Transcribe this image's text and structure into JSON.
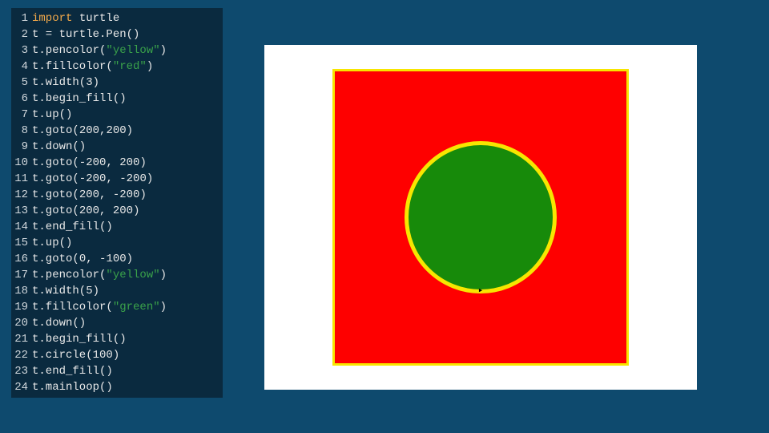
{
  "code": {
    "lines": [
      {
        "n": 1,
        "tokens": [
          [
            "kw",
            "import"
          ],
          [
            "plain",
            " turtle"
          ]
        ]
      },
      {
        "n": 2,
        "tokens": [
          [
            "plain",
            "t = turtle.Pen()"
          ]
        ]
      },
      {
        "n": 3,
        "tokens": [
          [
            "plain",
            "t.pencolor("
          ],
          [
            "str",
            "\"yellow\""
          ],
          [
            "plain",
            ")"
          ]
        ]
      },
      {
        "n": 4,
        "tokens": [
          [
            "plain",
            "t.fillcolor("
          ],
          [
            "str",
            "\"red\""
          ],
          [
            "plain",
            ")"
          ]
        ]
      },
      {
        "n": 5,
        "tokens": [
          [
            "plain",
            "t.width("
          ],
          [
            "num",
            "3"
          ],
          [
            "plain",
            ")"
          ]
        ]
      },
      {
        "n": 6,
        "tokens": [
          [
            "plain",
            "t.begin_fill()"
          ]
        ]
      },
      {
        "n": 7,
        "tokens": [
          [
            "plain",
            "t.up()"
          ]
        ]
      },
      {
        "n": 8,
        "tokens": [
          [
            "plain",
            "t.goto("
          ],
          [
            "num",
            "200"
          ],
          [
            "plain",
            ","
          ],
          [
            "num",
            "200"
          ],
          [
            "plain",
            ")"
          ]
        ]
      },
      {
        "n": 9,
        "tokens": [
          [
            "plain",
            "t.down()"
          ]
        ]
      },
      {
        "n": 10,
        "tokens": [
          [
            "plain",
            "t.goto(-"
          ],
          [
            "num",
            "200"
          ],
          [
            "plain",
            ", "
          ],
          [
            "num",
            "200"
          ],
          [
            "plain",
            ")"
          ]
        ]
      },
      {
        "n": 11,
        "tokens": [
          [
            "plain",
            "t.goto(-"
          ],
          [
            "num",
            "200"
          ],
          [
            "plain",
            ", -"
          ],
          [
            "num",
            "200"
          ],
          [
            "plain",
            ")"
          ]
        ]
      },
      {
        "n": 12,
        "tokens": [
          [
            "plain",
            "t.goto("
          ],
          [
            "num",
            "200"
          ],
          [
            "plain",
            ", -"
          ],
          [
            "num",
            "200"
          ],
          [
            "plain",
            ")"
          ]
        ]
      },
      {
        "n": 13,
        "tokens": [
          [
            "plain",
            "t.goto("
          ],
          [
            "num",
            "200"
          ],
          [
            "plain",
            ", "
          ],
          [
            "num",
            "200"
          ],
          [
            "plain",
            ")"
          ]
        ]
      },
      {
        "n": 14,
        "tokens": [
          [
            "plain",
            "t.end_fill()"
          ]
        ]
      },
      {
        "n": 15,
        "tokens": [
          [
            "plain",
            "t.up()"
          ]
        ]
      },
      {
        "n": 16,
        "tokens": [
          [
            "plain",
            "t.goto("
          ],
          [
            "num",
            "0"
          ],
          [
            "plain",
            ", -"
          ],
          [
            "num",
            "100"
          ],
          [
            "plain",
            ")"
          ]
        ]
      },
      {
        "n": 17,
        "tokens": [
          [
            "plain",
            "t.pencolor("
          ],
          [
            "str",
            "\"yellow\""
          ],
          [
            "plain",
            ")"
          ]
        ]
      },
      {
        "n": 18,
        "tokens": [
          [
            "plain",
            "t.width("
          ],
          [
            "num",
            "5"
          ],
          [
            "plain",
            ")"
          ]
        ]
      },
      {
        "n": 19,
        "tokens": [
          [
            "plain",
            "t.fillcolor("
          ],
          [
            "str",
            "\"green\""
          ],
          [
            "plain",
            ")"
          ]
        ]
      },
      {
        "n": 20,
        "tokens": [
          [
            "plain",
            "t.down()"
          ]
        ]
      },
      {
        "n": 21,
        "tokens": [
          [
            "plain",
            "t.begin_fill()"
          ]
        ]
      },
      {
        "n": 22,
        "tokens": [
          [
            "plain",
            "t.circle("
          ],
          [
            "num",
            "100"
          ],
          [
            "plain",
            ")"
          ]
        ]
      },
      {
        "n": 23,
        "tokens": [
          [
            "plain",
            "t.end_fill()"
          ]
        ]
      },
      {
        "n": 24,
        "tokens": [
          [
            "plain",
            "t.mainloop()"
          ]
        ]
      }
    ]
  },
  "output": {
    "square_fill": "#fe0000",
    "square_stroke": "#f7e600",
    "circle_fill": "#178a0a",
    "circle_stroke": "#f7e600",
    "canvas_bg": "#ffffff"
  }
}
